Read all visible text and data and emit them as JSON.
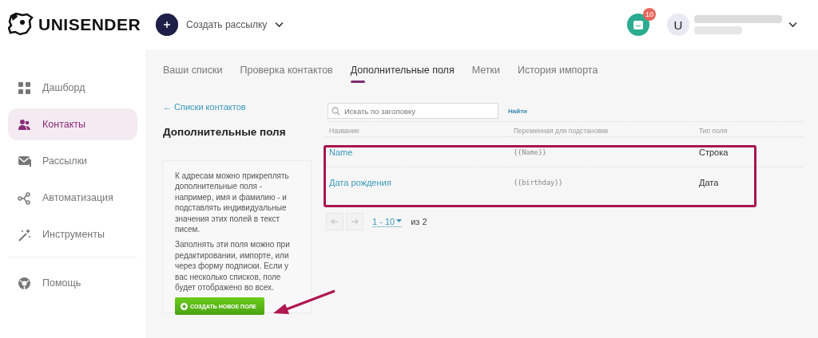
{
  "header": {
    "logo": "UNISENDER",
    "create_menu": "Создать рассылку",
    "notifications_badge": "10",
    "avatar": "U"
  },
  "sidebar": {
    "items": [
      {
        "label": "Дашборд",
        "selected": false
      },
      {
        "label": "Контакты",
        "selected": true
      },
      {
        "label": "Рассылки",
        "selected": false
      },
      {
        "label": "Автоматизация",
        "selected": false
      },
      {
        "label": "Инструменты",
        "selected": false
      }
    ],
    "footer_items": [
      {
        "label": "Помощь",
        "selected": false
      }
    ]
  },
  "tabs": [
    {
      "label": "Ваши списки",
      "selected": false
    },
    {
      "label": "Проверка контактов",
      "selected": false
    },
    {
      "label": "Дополнительные поля",
      "selected": true
    },
    {
      "label": "Метки",
      "selected": false
    },
    {
      "label": "История импорта",
      "selected": false
    }
  ],
  "back_link": "← Списки контактов",
  "page_title": "Дополнительные поля",
  "info": {
    "paragraphs": [
      "К адресам можно прикреплять дополнительные поля - например, имя и фамилию - и подставлять индивидуальные значения этих полей в текст писем.",
      "Заполнять эти поля можно при редактировании, импорте, или через форму подписки. Если у вас несколько списков, поле будет отображено во всех."
    ],
    "button": "СОЗДАТЬ НОВОЕ ПОЛЕ"
  },
  "search": {
    "placeholder": "Искать по заголовку",
    "button": "Найти"
  },
  "table": {
    "columns": [
      "Название",
      "Переменная для подстановки",
      "Тип поля"
    ],
    "rows": [
      [
        "Name",
        "{{Name}}",
        "Строка"
      ],
      [
        "Дата рождения",
        "{{birthday}}",
        "Дата"
      ]
    ]
  },
  "pagination": {
    "range": "1 - 10",
    "total": "из 2"
  }
}
